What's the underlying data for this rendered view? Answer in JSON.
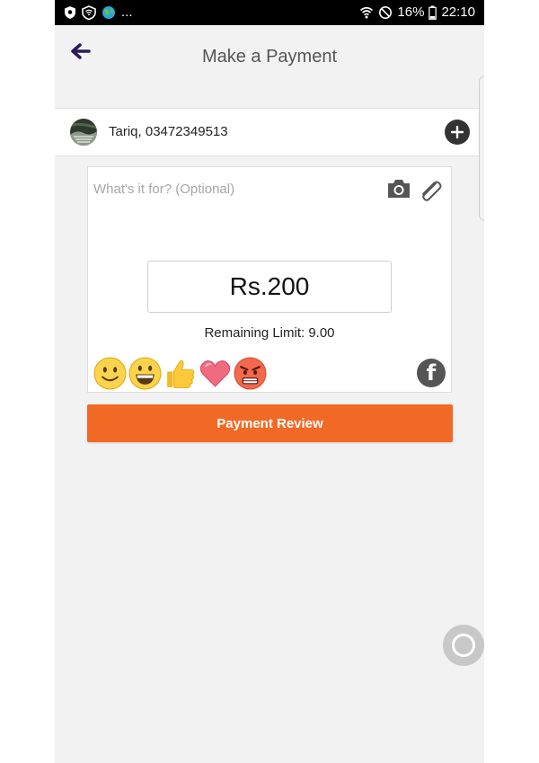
{
  "status_bar": {
    "left_icons": [
      "shield-icon",
      "vpn-icon",
      "globe-icon"
    ],
    "more": "...",
    "battery": "16%",
    "time": "22:10"
  },
  "header": {
    "title": "Make a Payment"
  },
  "recipient": {
    "text": "Tariq, 03472349513"
  },
  "note": {
    "placeholder": "What's it for? (Optional)"
  },
  "amount": {
    "value": "Rs.200"
  },
  "limit": {
    "text": "Remaining Limit: 9.00"
  },
  "emojis": [
    "slightly-smiling",
    "grinning",
    "thumbs-up",
    "heart",
    "angry"
  ],
  "button": {
    "label": "Payment Review"
  },
  "colors": {
    "accent": "#f26926",
    "back_arrow": "#2a1b5a",
    "status_bar": "#000000"
  }
}
